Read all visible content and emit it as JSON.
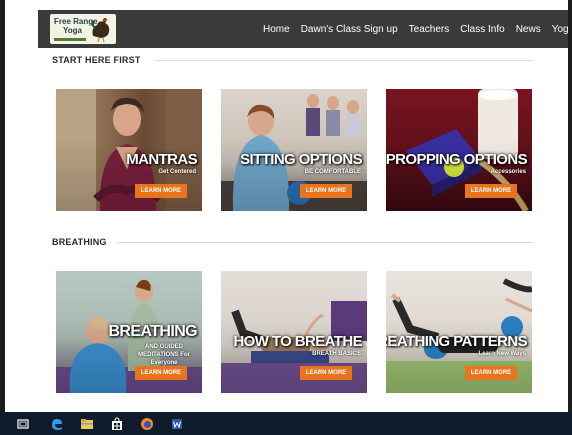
{
  "site": {
    "logo_line1": "Free Range",
    "logo_line2": "Yoga"
  },
  "nav": {
    "items": [
      "Home",
      "Dawn's Class Sign up",
      "Teachers",
      "Class Info",
      "News",
      "Yoga Th"
    ]
  },
  "sections": [
    {
      "title": "START HERE FIRST",
      "cards": [
        {
          "title": "MANTRAS",
          "subtitle": "Get Centered",
          "button": "LEARN MORE"
        },
        {
          "title": "SITTING OPTIONS",
          "subtitle": "BE COMFORTABLE",
          "button": "LEARN MORE"
        },
        {
          "title": "PROPPING OPTIONS",
          "subtitle": "Accessories",
          "button": "LEARN MORE"
        }
      ]
    },
    {
      "title": "BREATHING",
      "cards": [
        {
          "title": "BREATHING",
          "subtitle": "AND GUIDED MEDITATIONS For Everyone",
          "button": "LEARN MORE"
        },
        {
          "title": "HOW TO BREATHE",
          "subtitle": "BREATH BASICS",
          "button": "LEARN MORE"
        },
        {
          "title": "BREATHING PATTERNS",
          "subtitle": "Learn New Ways",
          "button": "LEARN MORE"
        }
      ]
    }
  ],
  "colors": {
    "navbar": "#3a3a3a",
    "button": "#e8741e",
    "taskbar": "#101b2b"
  }
}
